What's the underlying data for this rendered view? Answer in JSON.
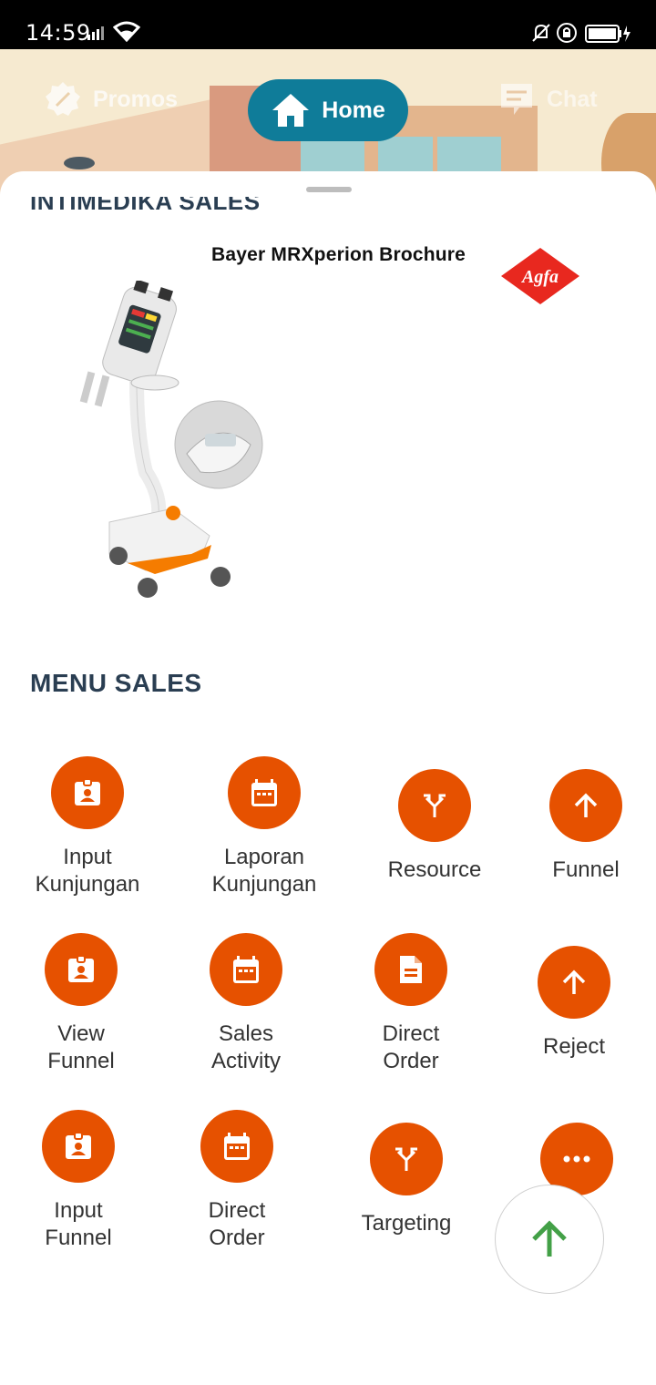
{
  "status_bar": {
    "time": "14:59"
  },
  "top_nav": {
    "promos": "Promos",
    "home": "Home",
    "chat": "Chat"
  },
  "section": {
    "title": "INTIMEDIKA SALES"
  },
  "banner": {
    "title": "Bayer MRXperion Brochure",
    "logo_text": "Agfa"
  },
  "menu": {
    "title": "MENU SALES",
    "items": [
      {
        "label": "Input\nKunjungan",
        "icon": "badge-icon"
      },
      {
        "label": "Laporan\nKunjungan",
        "icon": "calendar-icon"
      },
      {
        "label": "Resource",
        "icon": "merge-icon"
      },
      {
        "label": "Funnel",
        "icon": "arrow-up-icon"
      },
      {
        "label": "View\nFunnel",
        "icon": "badge-icon"
      },
      {
        "label": "Sales\nActivity",
        "icon": "calendar-icon"
      },
      {
        "label": "Direct\nOrder",
        "icon": "document-icon"
      },
      {
        "label": "Reject",
        "icon": "arrow-up-icon"
      },
      {
        "label": "Input\nFunnel",
        "icon": "badge-icon"
      },
      {
        "label": "Direct\nOrder",
        "icon": "calendar-icon"
      },
      {
        "label": "Targeting",
        "icon": "merge-icon"
      },
      {
        "label": "",
        "icon": "more-icon"
      }
    ]
  },
  "colors": {
    "accent": "#e65100",
    "nav_active": "#0f7c99",
    "heading": "#2a3e52",
    "fab_arrow": "#43a047"
  }
}
